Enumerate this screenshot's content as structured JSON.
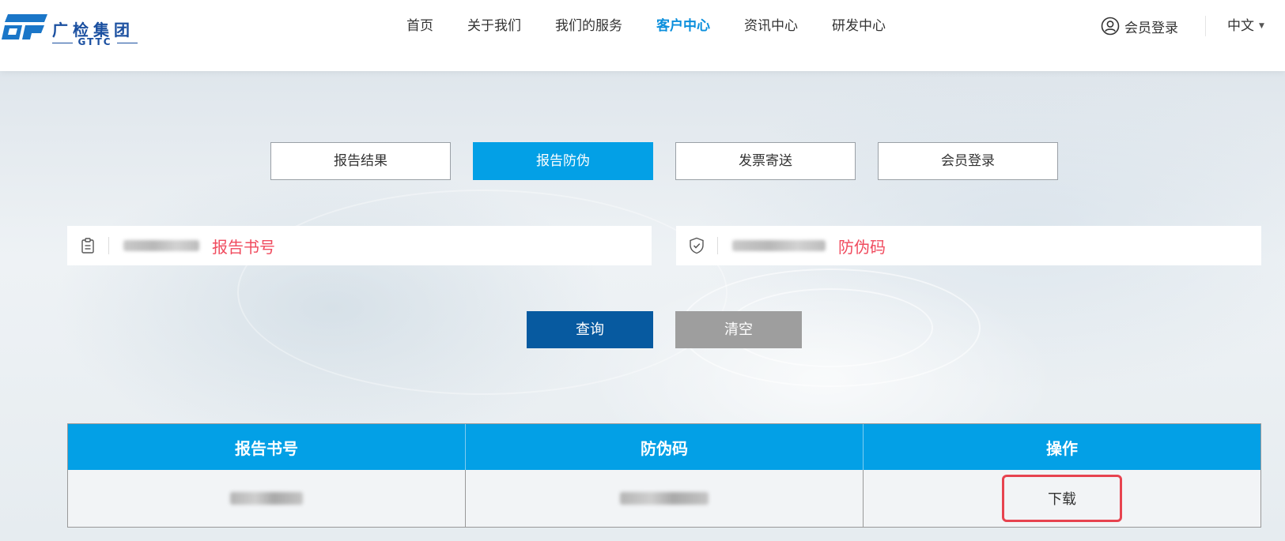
{
  "header": {
    "logo_cn": "广检集团",
    "logo_en": "GTTC",
    "nav": [
      "首页",
      "关于我们",
      "我们的服务",
      "客户中心",
      "资讯中心",
      "研发中心"
    ],
    "active_nav": "客户中心",
    "login_label": "会员登录",
    "lang_label": "中文",
    "accent_color": "#0b8fdc"
  },
  "tabs": [
    {
      "label": "报告结果",
      "active": false
    },
    {
      "label": "报告防伪",
      "active": true
    },
    {
      "label": "发票寄送",
      "active": false
    },
    {
      "label": "会员登录",
      "active": false
    }
  ],
  "form": {
    "report_no_hint": "报告书号",
    "anti_fake_hint": "防伪码",
    "query_label": "查询",
    "clear_label": "清空"
  },
  "table": {
    "headers": [
      "报告书号",
      "防伪码",
      "操作"
    ],
    "download_label": "下载"
  },
  "colors": {
    "brand_blue": "#03a0e6",
    "dark_blue": "#075aa0",
    "hint_red": "#f04b5e",
    "highlight_red": "#e7434f"
  }
}
